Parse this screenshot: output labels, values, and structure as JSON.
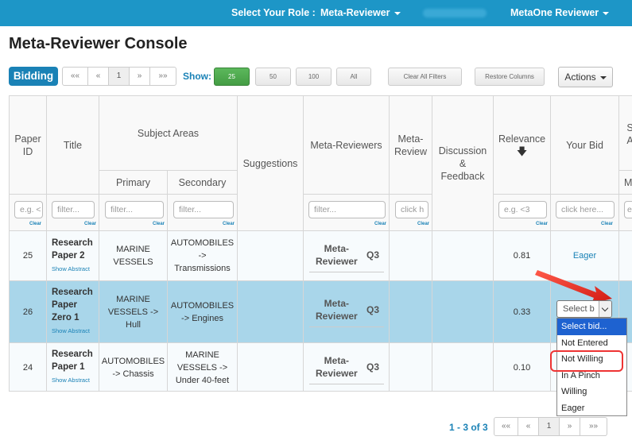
{
  "topbar": {
    "role_label": "Select Your Role :",
    "role_value": "Meta-Reviewer",
    "user_menu": "MetaOne Reviewer"
  },
  "page": {
    "title": "Meta-Reviewer Console"
  },
  "toolbar": {
    "bidding_label": "Bidding",
    "pager_top": [
      "««",
      "«",
      "1",
      "»",
      "»»"
    ],
    "show_label": "Show:",
    "page_sizes": [
      "25",
      "50",
      "100",
      "All"
    ],
    "selected_page_size": "25",
    "clear_filters": "Clear All Filters",
    "restore_columns": "Restore Columns",
    "actions": "Actions"
  },
  "table": {
    "headers": {
      "paper_id": "Paper ID",
      "title": "Title",
      "subject_areas": "Subject Areas",
      "primary": "Primary",
      "secondary": "Secondary",
      "suggestions": "Suggestions",
      "meta_reviewers": "Meta-Reviewers",
      "meta_review": "Meta-Review",
      "discussion": "Discussion & Feedback",
      "relevance": "Relevance",
      "relevance_sort_icon": "down-arrow-icon",
      "your_bid": "Your Bid",
      "cut_s": "S",
      "cut_a": "A",
      "cut_m": "M"
    },
    "filters": {
      "paper_id": "e.g. <",
      "title": "filter...",
      "primary": "filter...",
      "secondary": "filter...",
      "meta_reviewers": "filter...",
      "meta_review": "click h",
      "relevance": "e.g. <3",
      "your_bid": "click here...",
      "cut": "e",
      "clear_label": "Clear"
    },
    "rows": [
      {
        "id": "25",
        "title": "Research Paper 2",
        "title_lines": [
          "Research",
          "Paper 2"
        ],
        "show_abstract": "Show Abstract",
        "primary": [
          "MARINE",
          "VESSELS"
        ],
        "secondary": [
          "AUTOMOBILES",
          "->",
          "Transmissions"
        ],
        "meta_reviewer": [
          "Meta-",
          "Reviewer"
        ],
        "quartile": "Q3",
        "relevance": "0.81",
        "bid": "Eager"
      },
      {
        "id": "26",
        "title": "Research Paper Zero 1",
        "title_lines": [
          "Research",
          "Paper",
          "Zero 1"
        ],
        "show_abstract": "Show Abstract",
        "primary": [
          "MARINE",
          "VESSELS ->",
          "Hull"
        ],
        "secondary": [
          "AUTOMOBILES",
          "-> Engines"
        ],
        "meta_reviewer": [
          "Meta-",
          "Reviewer"
        ],
        "quartile": "Q3",
        "relevance": "0.33",
        "bid": "Select b"
      },
      {
        "id": "24",
        "title": "Research Paper 1",
        "title_lines": [
          "Research",
          "Paper 1"
        ],
        "show_abstract": "Show Abstract",
        "primary": [
          "AUTOMOBILES",
          "-> Chassis"
        ],
        "secondary": [
          "MARINE",
          "VESSELS ->",
          "Under 40-feet"
        ],
        "meta_reviewer": [
          "Meta-",
          "Reviewer"
        ],
        "quartile": "Q3",
        "relevance": "0.10",
        "bid": ""
      }
    ]
  },
  "bid_dropdown": {
    "options": [
      "Select bid...",
      "Not Entered",
      "Not Willing",
      "In A Pinch",
      "Willing",
      "Eager"
    ],
    "highlighted": "Select bid...",
    "annotated": "Not Willing",
    "annotation_color": "#ee3333",
    "highlight_color": "#f7f022"
  },
  "footer": {
    "range": "1 - 3 of 3",
    "pager": [
      "««",
      "«",
      "1",
      "»",
      "»»"
    ]
  },
  "colors": {
    "brand": "#1d96c7",
    "accent": "#1a82b6",
    "selected_row": "#a9d6ea",
    "green": "#5cb85c"
  }
}
